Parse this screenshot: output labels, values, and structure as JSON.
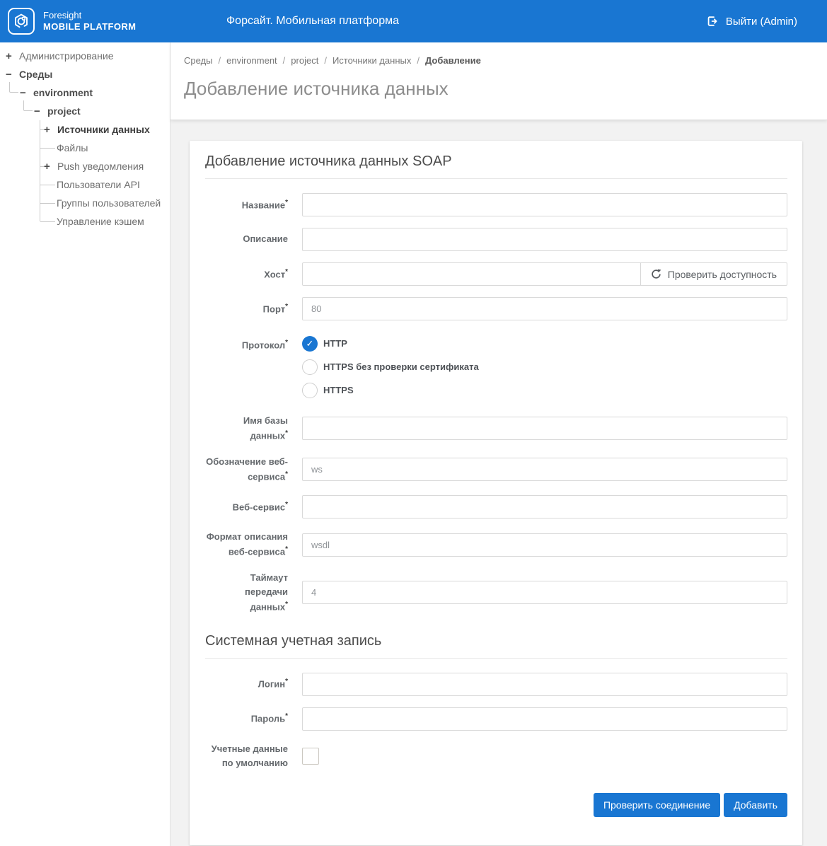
{
  "colors": {
    "primary": "#1976d2",
    "page_bg": "#f2f2f2",
    "card_bg": "#ffffff"
  },
  "header": {
    "logo_line1": "Foresight",
    "logo_line2": "MOBILE PLATFORM",
    "app_title": "Форсайт. Мобильная платформа",
    "logout_label": "Выйти (Admin)"
  },
  "icons": {
    "logout": "sign-out-icon",
    "refresh": "refresh-icon",
    "radio_check": "✓"
  },
  "sidebar": {
    "items": [
      {
        "label": "Администрирование",
        "toggle": "+"
      },
      {
        "label": "Среды",
        "toggle": "−"
      },
      {
        "label": "environment",
        "toggle": "−"
      },
      {
        "label": "project",
        "toggle": "−"
      },
      {
        "label": "Источники данных",
        "toggle": "+"
      },
      {
        "label": "Файлы",
        "toggle": ""
      },
      {
        "label": "Push уведомления",
        "toggle": "+"
      },
      {
        "label": "Пользователи API",
        "toggle": ""
      },
      {
        "label": "Группы пользователей",
        "toggle": ""
      },
      {
        "label": "Управление кэшем",
        "toggle": ""
      }
    ]
  },
  "breadcrumb": {
    "separator": "/",
    "items": [
      "Среды",
      "environment",
      "project",
      "Источники данных",
      "Добавление"
    ]
  },
  "page_title": "Добавление источника данных",
  "form": {
    "required_marker": "*",
    "section_soap_title": "Добавление источника данных SOAP",
    "section_account_title": "Системная учетная запись",
    "labels": {
      "name": "Название",
      "description": "Описание",
      "host": "Хост",
      "port": "Порт",
      "protocol": "Протокол",
      "db_name": "Имя базы данных",
      "ws_alias": "Обозначение веб-сервиса",
      "web_service": "Веб-сервис",
      "ws_format": "Формат описания веб-сервиса",
      "timeout": "Таймаут передачи данных",
      "login": "Логин",
      "password": "Пароль",
      "default_credentials": "Учетные данные по умолчанию"
    },
    "values": {
      "name": "",
      "description": "",
      "host": "",
      "port": "80",
      "db_name": "",
      "ws_alias": "ws",
      "web_service": "",
      "ws_format": "wsdl",
      "timeout": "4",
      "login": "",
      "password": ""
    },
    "check_availability_label": "Проверить доступность",
    "protocol_options": [
      {
        "label": "HTTP",
        "selected": true
      },
      {
        "label": "HTTPS без проверки сертификата",
        "selected": false
      },
      {
        "label": "HTTPS",
        "selected": false
      }
    ],
    "default_credentials_checked": false,
    "buttons": {
      "check_connection": "Проверить соединение",
      "add": "Добавить"
    }
  }
}
